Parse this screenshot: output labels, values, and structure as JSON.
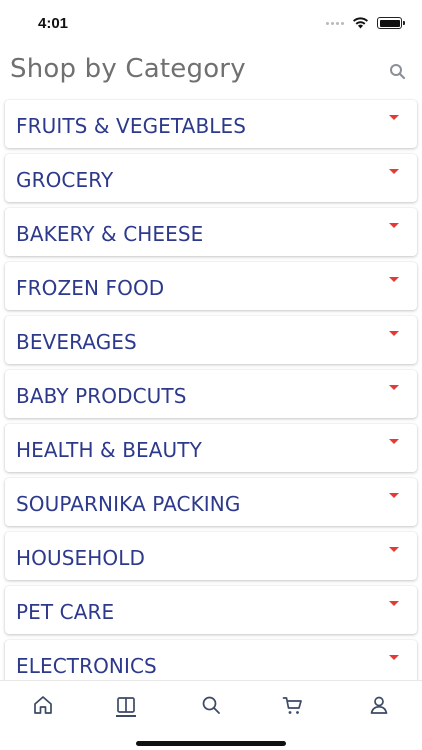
{
  "status_bar": {
    "time": "4:01"
  },
  "header": {
    "title": "Shop by Category",
    "search_icon": "search-icon"
  },
  "categories": [
    {
      "label": "FRUITS & VEGETABLES"
    },
    {
      "label": "GROCERY"
    },
    {
      "label": "BAKERY & CHEESE"
    },
    {
      "label": "FROZEN FOOD"
    },
    {
      "label": "BEVERAGES"
    },
    {
      "label": "BABY PRODCUTS"
    },
    {
      "label": "HEALTH & BEAUTY"
    },
    {
      "label": "SOUPARNIKA PACKING"
    },
    {
      "label": "HOUSEHOLD"
    },
    {
      "label": "PET CARE"
    },
    {
      "label": "ELECTRONICS"
    }
  ],
  "tab_bar": {
    "tabs": [
      {
        "icon": "home-icon",
        "active": false
      },
      {
        "icon": "book-icon",
        "active": true
      },
      {
        "icon": "search-icon",
        "active": false
      },
      {
        "icon": "cart-icon",
        "active": false
      },
      {
        "icon": "user-icon",
        "active": false
      }
    ]
  },
  "colors": {
    "category_text": "#2d3a8c",
    "caret": "#e53935",
    "title": "#707070",
    "tab_icon": "#3c4a66"
  }
}
